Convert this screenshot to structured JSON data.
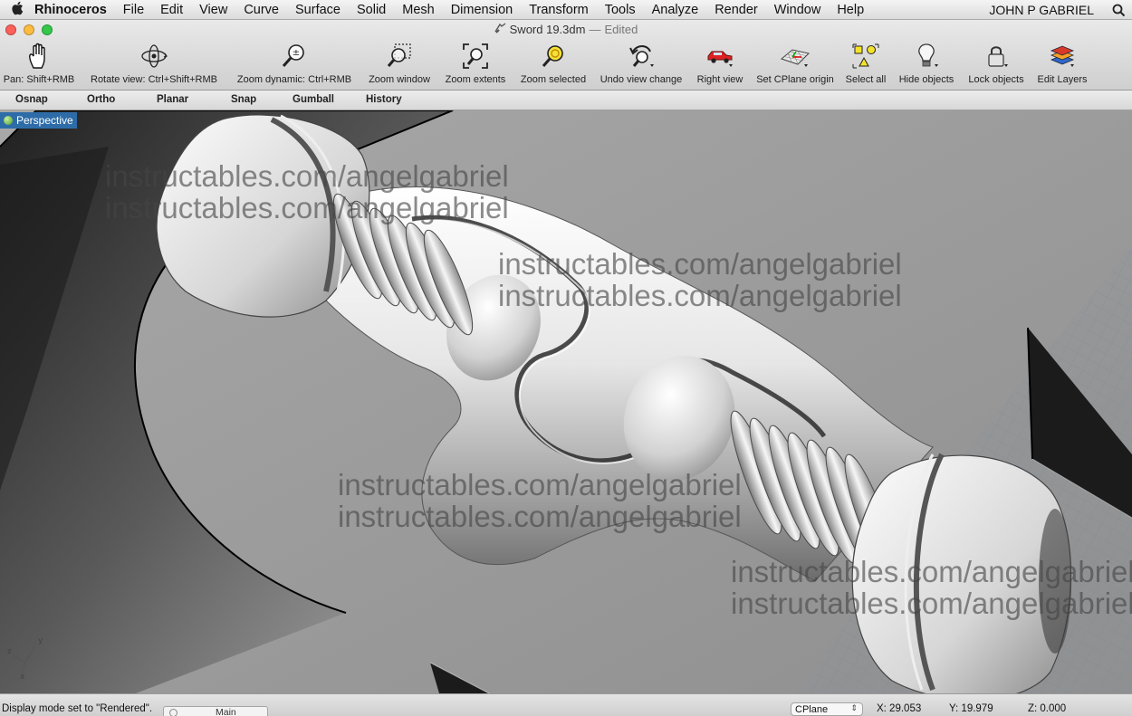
{
  "menubar": {
    "apple_icon": "apple-logo",
    "app_name": "Rhinoceros",
    "items": [
      "File",
      "Edit",
      "View",
      "Curve",
      "Surface",
      "Solid",
      "Mesh",
      "Dimension",
      "Transform",
      "Tools",
      "Analyze",
      "Render",
      "Window",
      "Help"
    ],
    "user": "JOHN P GABRIEL",
    "search_icon": "spotlight-search-icon"
  },
  "window": {
    "title": "Sword 19.3dm",
    "separator": "—",
    "edited": "Edited"
  },
  "toolbar": {
    "tools": [
      {
        "label": "Pan: Shift+RMB",
        "icon": "hand-pan-icon"
      },
      {
        "label": "Rotate view: Ctrl+Shift+RMB",
        "icon": "rotate-view-icon"
      },
      {
        "label": "Zoom dynamic: Ctrl+RMB",
        "icon": "zoom-dynamic-icon"
      },
      {
        "label": "Zoom window",
        "icon": "zoom-window-icon"
      },
      {
        "label": "Zoom extents",
        "icon": "zoom-extents-icon"
      },
      {
        "label": "Zoom selected",
        "icon": "zoom-selected-icon"
      },
      {
        "label": "Undo view change",
        "icon": "undo-view-icon"
      },
      {
        "label": "Right view",
        "icon": "right-view-car-icon"
      },
      {
        "label": "Set CPlane origin",
        "icon": "cplane-origin-icon"
      },
      {
        "label": "Select all",
        "icon": "select-all-icon"
      },
      {
        "label": "Hide objects",
        "icon": "lightbulb-hide-icon"
      },
      {
        "label": "Lock objects",
        "icon": "padlock-icon"
      },
      {
        "label": "Edit Layers",
        "icon": "layers-icon"
      }
    ]
  },
  "command_bar": {
    "toggles": [
      "Osnap",
      "Ortho",
      "Planar",
      "Snap",
      "Gumball",
      "History"
    ]
  },
  "viewport": {
    "name": "Perspective",
    "watermark": "instructables.com/angelgabriel",
    "axis_labels": {
      "x": "x",
      "y": "y",
      "z": "z"
    }
  },
  "statusbar": {
    "message": "Display mode set to \"Rendered\".",
    "layer": "Main",
    "cplane": "CPlane",
    "x": "X: 29.053",
    "y": "Y: 19.979",
    "z": "Z: 0.000"
  },
  "colors": {
    "viewport_bg": "#9e9e9e",
    "tab_blue": "#2e6ca8",
    "close": "#fc605b",
    "minimize": "#fdbc40",
    "zoom": "#34c84a"
  }
}
